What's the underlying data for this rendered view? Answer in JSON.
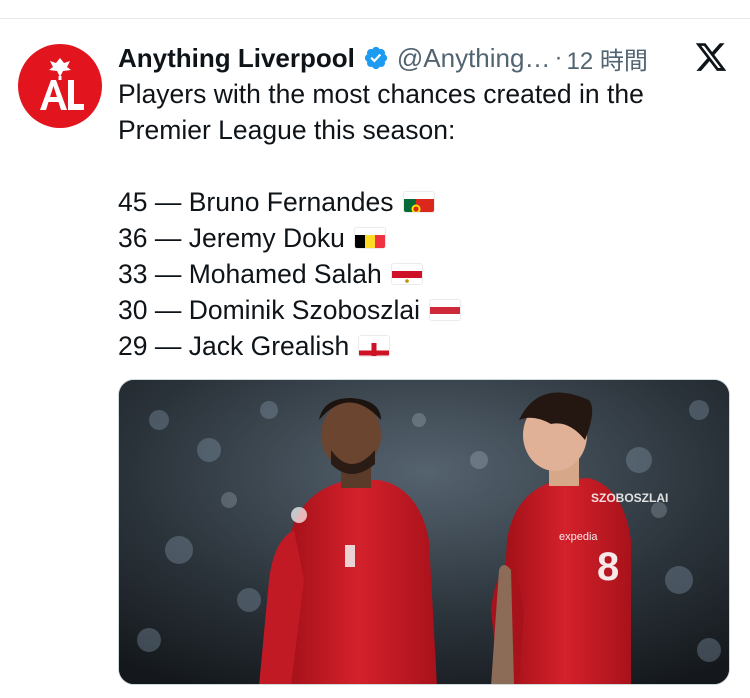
{
  "tweet": {
    "author": {
      "display_name": "Anything Liverpool",
      "handle": "@Anything…",
      "avatar_icon": "anything-liverpool-logo",
      "verified": true
    },
    "separator": "·",
    "timestamp": "12 時間",
    "platform_icon": "x-logo-icon",
    "text_lines": [
      "Players with the most chances created in the",
      "Premier League this season:"
    ],
    "ranking": [
      {
        "count": "45",
        "dash": "—",
        "player": "Bruno Fernandes",
        "flag": "portugal-flag-icon"
      },
      {
        "count": "36",
        "dash": "—",
        "player": "Jeremy Doku",
        "flag": "belgium-flag-icon"
      },
      {
        "count": "33",
        "dash": "—",
        "player": "Mohamed Salah",
        "flag": "egypt-flag-icon"
      },
      {
        "count": "30",
        "dash": "—",
        "player": "Dominik Szoboszlai",
        "flag": "hungary-flag-icon"
      },
      {
        "count": "29",
        "dash": "—",
        "player": "Jack Grealish",
        "flag": "england-flag-icon"
      }
    ],
    "media": {
      "shirt_text": "SZOBOSZLAI",
      "shirt_number": "8",
      "sponsor": "expedia"
    }
  },
  "colors": {
    "brand_red": "#e2151f",
    "verified_blue": "#1d9bf0",
    "secondary_text": "#536471"
  }
}
